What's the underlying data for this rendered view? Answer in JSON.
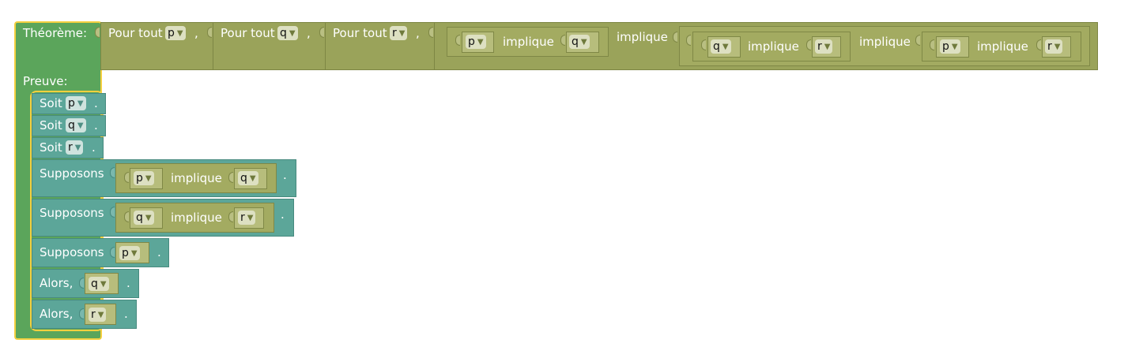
{
  "theorem": {
    "label": "Théorème:",
    "proof_label": "Preuve:",
    "quantifiers": [
      {
        "label": "Pour tout",
        "var": "p",
        "sep": ","
      },
      {
        "label": "Pour tout",
        "var": "q",
        "sep": ","
      },
      {
        "label": "Pour tout",
        "var": "r",
        "sep": ","
      }
    ],
    "statement": {
      "main_implies": "implique",
      "left": {
        "a": "p",
        "op": "implique",
        "b": "q"
      },
      "right": {
        "op": "implique",
        "left": {
          "a": "q",
          "op": "implique",
          "b": "r"
        },
        "right": {
          "a": "p",
          "op": "implique",
          "b": "r"
        }
      }
    }
  },
  "proof": [
    {
      "kind": "soit",
      "label": "Soit",
      "var": "p",
      "end": "."
    },
    {
      "kind": "soit",
      "label": "Soit",
      "var": "q",
      "end": "."
    },
    {
      "kind": "soit",
      "label": "Soit",
      "var": "r",
      "end": "."
    },
    {
      "kind": "supposons",
      "label": "Supposons",
      "a": "p",
      "op": "implique",
      "b": "q",
      "end": "."
    },
    {
      "kind": "supposons",
      "label": "Supposons",
      "a": "q",
      "op": "implique",
      "b": "r",
      "end": "."
    },
    {
      "kind": "supposons",
      "label": "Supposons",
      "var": "p",
      "end": "."
    },
    {
      "kind": "alors",
      "label": "Alors,",
      "var": "q",
      "end": "."
    },
    {
      "kind": "alors",
      "label": "Alors,",
      "var": "r",
      "end": "."
    }
  ],
  "colors": {
    "theorem_block": "#5ba55b",
    "selection_outline": "#f4d03f",
    "logic_block": "#9aa35a",
    "statement_block": "#5ca699",
    "variable_chip": "#dde0c2"
  },
  "icons": [
    "dropdown-caret-icon"
  ]
}
